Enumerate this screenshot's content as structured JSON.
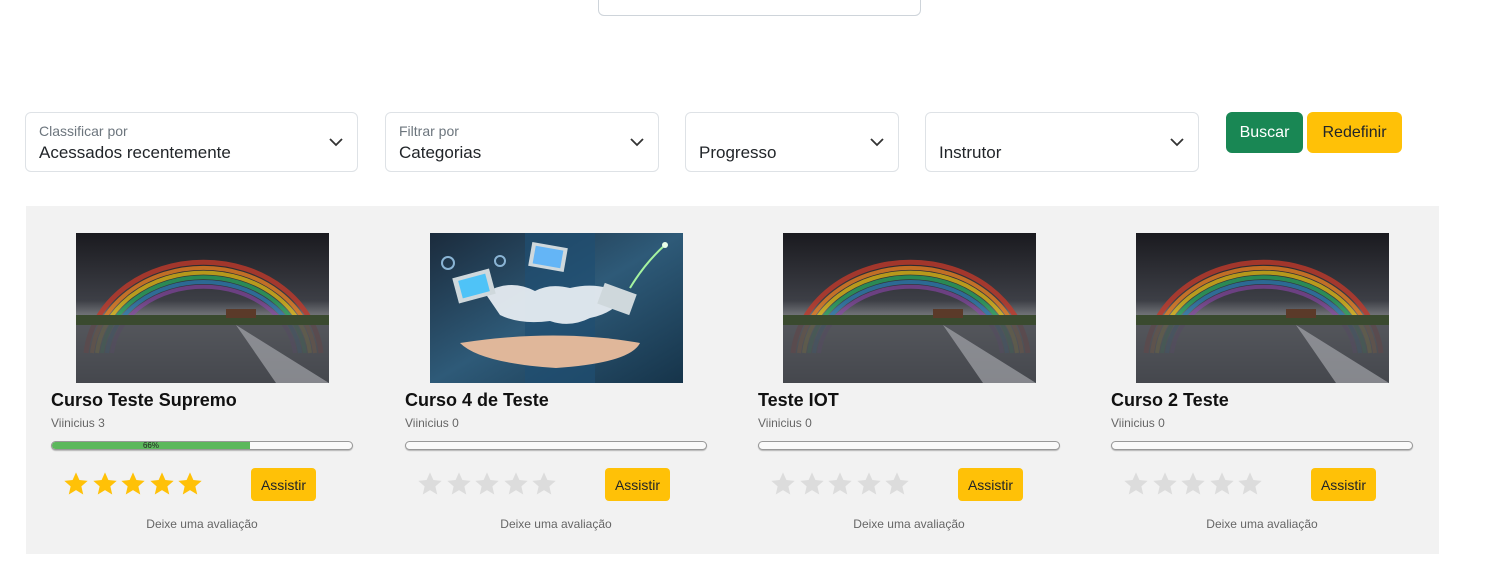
{
  "filters": {
    "sort": {
      "label": "Classificar por",
      "value": "Acessados recentemente"
    },
    "filter": {
      "label": "Filtrar por",
      "value": "Categorias"
    },
    "progress": {
      "label": "",
      "value": "Progresso"
    },
    "instructor": {
      "label": "",
      "value": "Instrutor"
    }
  },
  "buttons": {
    "search": "Buscar",
    "reset": "Redefinir"
  },
  "colors": {
    "green": "#198754",
    "yellow": "#ffc107",
    "progress": "#5cb85c",
    "star_on": "#ffc107",
    "star_off": "#dcdcdc"
  },
  "courses": [
    {
      "title": "Curso Teste Supremo",
      "instructor": "Viinicius 3",
      "progress": 0.66,
      "progress_label": "66%",
      "rating": 5,
      "thumbnail": "rainbow-lake",
      "action": "Assistir",
      "review_text": "Deixe uma avaliação"
    },
    {
      "title": "Curso 4 de Teste",
      "instructor": "Viinicius 0",
      "progress": 0,
      "progress_label": "",
      "rating": 0,
      "thumbnail": "tech-hand-world",
      "action": "Assistir",
      "review_text": "Deixe uma avaliação"
    },
    {
      "title": "Teste IOT",
      "instructor": "Viinicius 0",
      "progress": 0,
      "progress_label": "",
      "rating": 0,
      "thumbnail": "rainbow-lake",
      "action": "Assistir",
      "review_text": "Deixe uma avaliação"
    },
    {
      "title": "Curso 2 Teste",
      "instructor": "Viinicius 0",
      "progress": 0,
      "progress_label": "",
      "rating": 0,
      "thumbnail": "rainbow-lake",
      "action": "Assistir",
      "review_text": "Deixe uma avaliação"
    }
  ]
}
